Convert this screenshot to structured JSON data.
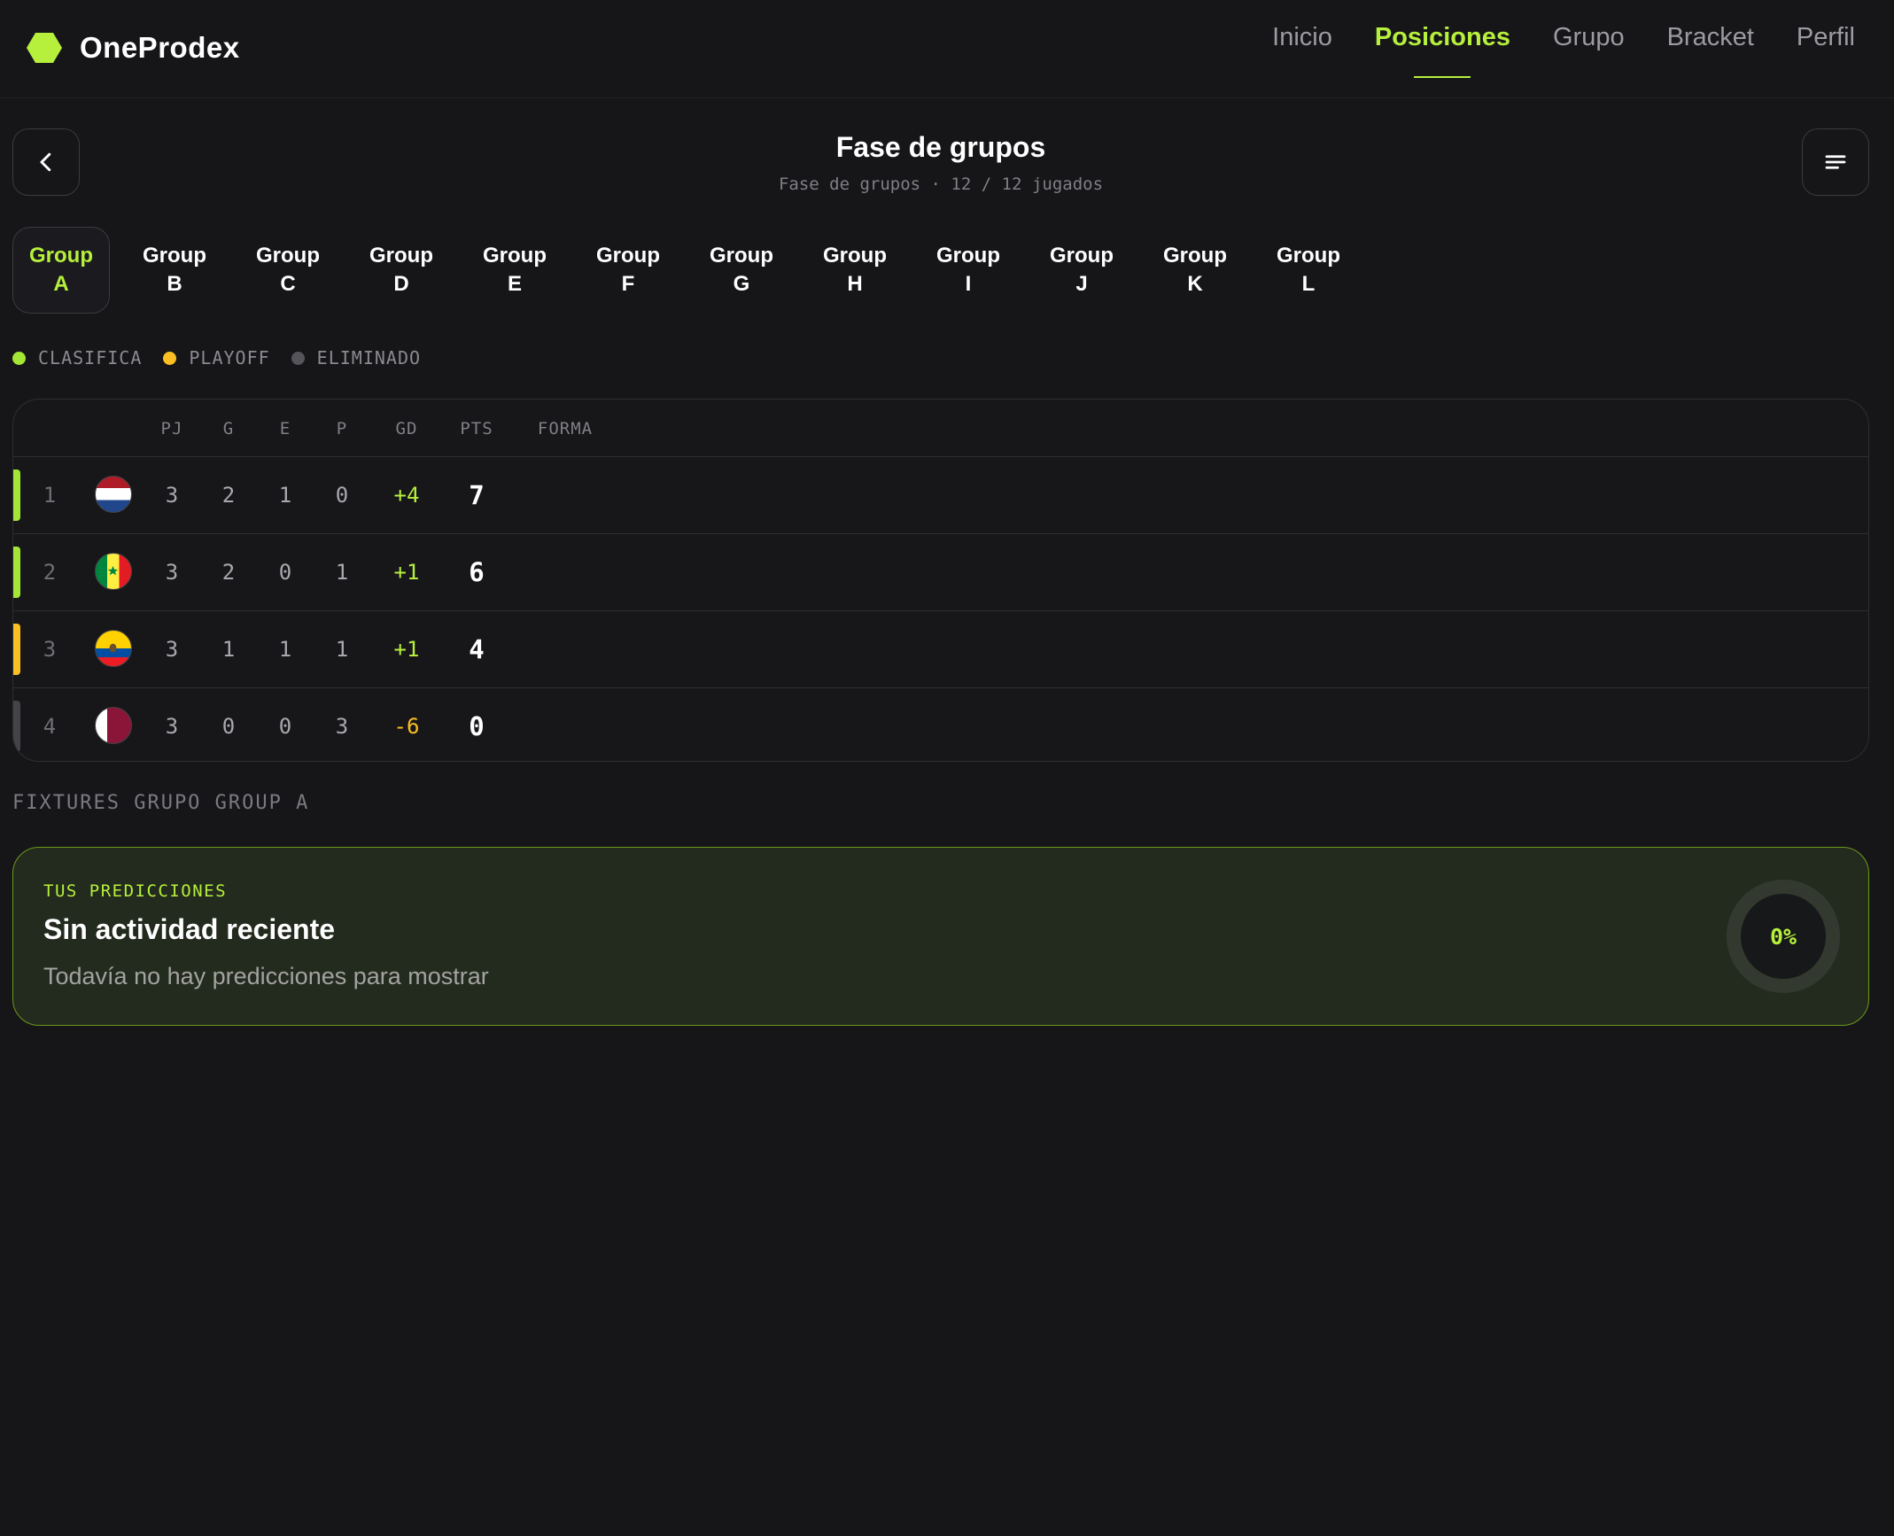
{
  "brand": {
    "name": "OneProdex",
    "logo_icon": "hexagon-logo-icon"
  },
  "nav": {
    "items": [
      {
        "label": "Inicio",
        "active": false
      },
      {
        "label": "Posiciones",
        "active": true
      },
      {
        "label": "Grupo",
        "active": false
      },
      {
        "label": "Bracket",
        "active": false
      },
      {
        "label": "Perfil",
        "active": false
      }
    ]
  },
  "header": {
    "title": "Fase de grupos",
    "subtitle": "Fase de grupos · 12 / 12 jugados",
    "back_icon": "chevron-left-icon",
    "menu_icon": "menu-lines-icon"
  },
  "tabs": [
    {
      "word": "Group",
      "letter": "A",
      "active": true
    },
    {
      "word": "Group",
      "letter": "B",
      "active": false
    },
    {
      "word": "Group",
      "letter": "C",
      "active": false
    },
    {
      "word": "Group",
      "letter": "D",
      "active": false
    },
    {
      "word": "Group",
      "letter": "E",
      "active": false
    },
    {
      "word": "Group",
      "letter": "F",
      "active": false
    },
    {
      "word": "Group",
      "letter": "G",
      "active": false
    },
    {
      "word": "Group",
      "letter": "H",
      "active": false
    },
    {
      "word": "Group",
      "letter": "I",
      "active": false
    },
    {
      "word": "Group",
      "letter": "J",
      "active": false
    },
    {
      "word": "Group",
      "letter": "K",
      "active": false
    },
    {
      "word": "Group",
      "letter": "L",
      "active": false
    }
  ],
  "legend": [
    {
      "label": "CLASIFICA",
      "color": "#a3e635"
    },
    {
      "label": "PLAYOFF",
      "color": "#fbbf24"
    },
    {
      "label": "ELIMINADO",
      "color": "#555559"
    }
  ],
  "table": {
    "columns": [
      "PJ",
      "G",
      "E",
      "P",
      "GD",
      "PTS",
      "FORMA"
    ],
    "rows": [
      {
        "pos": "1",
        "flag": "netherlands-flag-icon",
        "status": "clasifica",
        "pj": "3",
        "g": "2",
        "e": "1",
        "p": "0",
        "gd": "+4",
        "pts": "7"
      },
      {
        "pos": "2",
        "flag": "senegal-flag-icon",
        "status": "clasifica",
        "pj": "3",
        "g": "2",
        "e": "0",
        "p": "1",
        "gd": "+1",
        "pts": "6"
      },
      {
        "pos": "3",
        "flag": "ecuador-flag-icon",
        "status": "playoff",
        "pj": "3",
        "g": "1",
        "e": "1",
        "p": "1",
        "gd": "+1",
        "pts": "4"
      },
      {
        "pos": "4",
        "flag": "qatar-flag-icon",
        "status": "eliminado",
        "pj": "3",
        "g": "0",
        "e": "0",
        "p": "3",
        "gd": "-6",
        "pts": "0"
      }
    ]
  },
  "colors": {
    "accent": "#b6f03c",
    "clasifica": "#a3e635",
    "playoff": "#fbbf24",
    "eliminado": "#444448",
    "gd_positive": "#b6f03c",
    "gd_negative": "#fbbf24"
  },
  "fixtures": {
    "label": "FIXTURES GRUPO GROUP A"
  },
  "predictions": {
    "kicker": "TUS PREDICCIONES",
    "title": "Sin actividad reciente",
    "text": "Todavía no hay predicciones para mostrar",
    "percent": "0%",
    "progress": 0
  }
}
